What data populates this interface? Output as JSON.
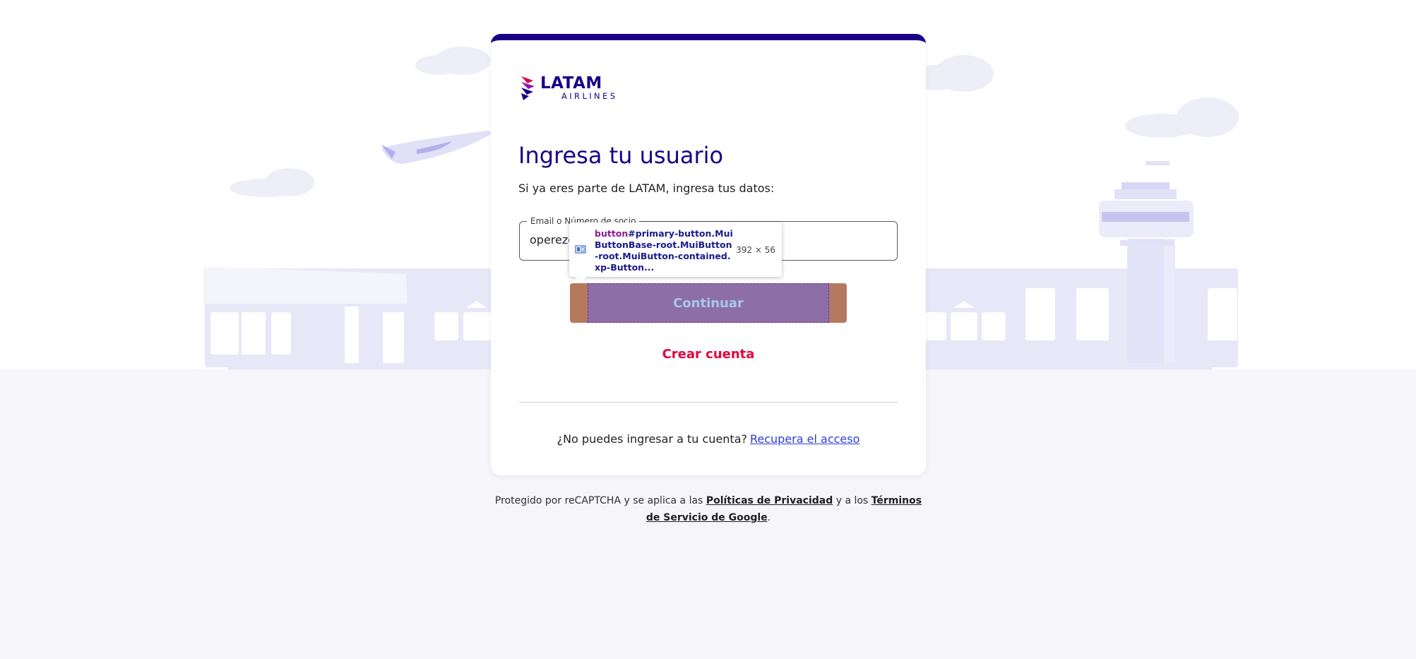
{
  "login": {
    "logo_word": "LATAM",
    "logo_sub": "AIRLINES",
    "title": "Ingresa tu usuario",
    "subtitle": "Si ya eres parte de LATAM, ingresa tus datos:",
    "email_label": "Email o Número de socio",
    "email_value": "operezó",
    "continue_label": "Continuar",
    "create_label": "Crear cuenta",
    "recover_text": "¿No puedes ingresar a tu cuenta?",
    "recover_link": "Recupera el acceso"
  },
  "footer": {
    "prefix": "Protegido por reCAPTCHA y se aplica a las",
    "privacy_link": "Políticas de Privacidad",
    "middle": "y a los",
    "terms_link": "Términos de Servicio de Google",
    "suffix": "."
  },
  "inspector_tooltip": {
    "tag": "button",
    "selector": "#primary-button.MuiButtonBase-root.MuiButton-root.MuiButton-contained.xp-Button...",
    "dimensions": "392 × 56"
  },
  "colors": {
    "brand_indigo": "#1b0088",
    "brand_red": "#e3003d",
    "link_blue": "#2b3fd6",
    "scenery": "#e4e4f7"
  },
  "icons": [
    "latam-logo-icon",
    "airplane-icon",
    "cloud-icon",
    "control-tower-icon",
    "inspector-flex-icon"
  ]
}
